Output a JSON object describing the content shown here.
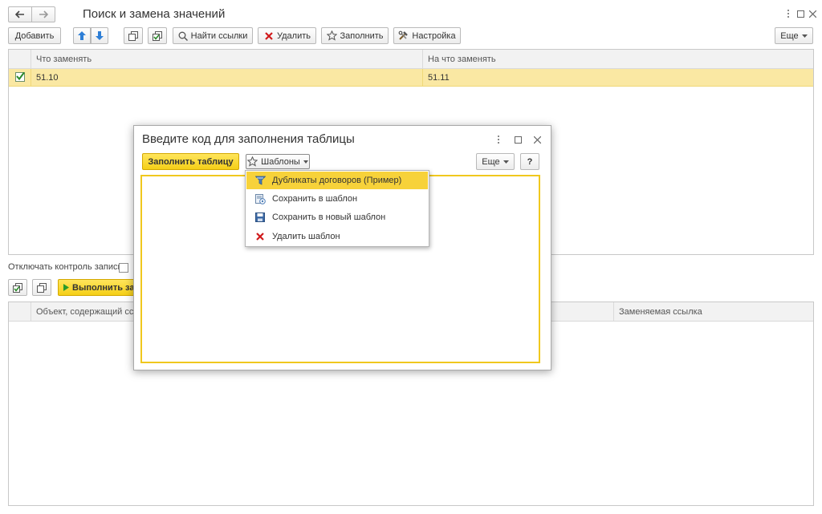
{
  "window": {
    "title": "Поиск и замена значений",
    "controls": [
      "more-vert-icon",
      "maximize-icon",
      "close-icon"
    ]
  },
  "toolbar": {
    "add_label": "Добавить",
    "find_links_label": "Найти ссылки",
    "delete_label": "Удалить",
    "fill_label": "Заполнить",
    "settings_label": "Настройка",
    "more_label": "Еще"
  },
  "replace_table": {
    "columns": [
      "Что заменять",
      "На что заменять"
    ],
    "rows": [
      {
        "checked": true,
        "from": "51.10",
        "to": "51.11"
      }
    ]
  },
  "control": {
    "disable_write_check_label": "Отключать контроль записи:"
  },
  "action": {
    "execute_label": "Выполнить за"
  },
  "results_table": {
    "columns": [
      "Объект, содержащий ссы",
      "Заменяемая ссылка"
    ]
  },
  "dialog": {
    "title": "Введите код для заполнения таблицы",
    "fill_table_label": "Заполнить таблицу",
    "templates_label": "Шаблоны",
    "more_label": "Еще",
    "help_label": "?"
  },
  "templates_menu": {
    "items": [
      {
        "label": "Дубликаты договоров (Пример)",
        "icon": "template-list-icon",
        "active": true
      },
      {
        "label": "Сохранить в шаблон",
        "icon": "save-to-template-icon",
        "active": false
      },
      {
        "label": "Сохранить в новый шаблон",
        "icon": "floppy-disk-icon",
        "active": false
      },
      {
        "label": "Удалить шаблон",
        "icon": "red-x-icon",
        "active": false
      }
    ]
  },
  "colors": {
    "accent_yellow": "#f5cf17",
    "selection_row": "#fae8a3",
    "delete_red": "#d0191b",
    "arrow_blue": "#2d7ed6",
    "check_green": "#2a8a2a"
  }
}
